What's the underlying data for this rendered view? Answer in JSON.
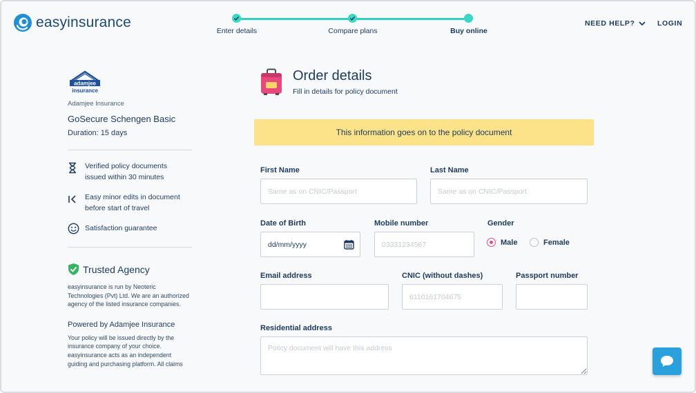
{
  "brand": {
    "name": "easyinsurance",
    "accent": "#2fd1c0",
    "primary": "#1b3a5c",
    "logo_icon": "easyinsurance-logo-icon"
  },
  "stepper": {
    "steps": [
      {
        "label": "Enter details",
        "state": "done"
      },
      {
        "label": "Compare plans",
        "state": "done"
      },
      {
        "label": "Buy online",
        "state": "current"
      }
    ]
  },
  "nav": {
    "help_label": "NEED HELP?",
    "login_label": "LOGIN"
  },
  "sidebar": {
    "insurer_logo_text": "adamjee insurance",
    "insurer_name": "Adamjee Insurance",
    "plan_name": "GoSecure Schengen Basic",
    "duration": "Duration: 15 days",
    "features": [
      {
        "icon": "hourglass-icon",
        "line1": "Verified policy documents",
        "line2": "issued within 30 minutes"
      },
      {
        "icon": "edit-back-icon",
        "line1": "Easy minor edits in document",
        "line2": "before start of travel"
      },
      {
        "icon": "smiley-icon",
        "line1": "Satisfaction guarantee",
        "line2": ""
      }
    ],
    "trusted_title": "Trusted Agency",
    "trusted_text": "easyinsurance is run by Neoteric Technologies (Pvt) Ltd. We are an authorized agency of the listed insurance companies.",
    "powered_title": "Powered by Adamjee Insurance",
    "powered_text": "Your policy will be issued directly by the insurance company of your choice. easyinsurance acts as an independent guiding and purchasing platform. All claims procedures would be handled by the"
  },
  "order": {
    "title": "Order details",
    "subtitle": "Fill in details for policy document",
    "notice": "This information goes on to the policy document"
  },
  "form": {
    "first_name": {
      "label": "First Name",
      "placeholder": "Same as on CNIC/Passport",
      "value": ""
    },
    "last_name": {
      "label": "Last Name",
      "placeholder": "Same as on CNIC/Passport",
      "value": ""
    },
    "dob": {
      "label": "Date of Birth",
      "value": "dd/mm/yyyy"
    },
    "mobile": {
      "label": "Mobile number",
      "placeholder": "03331234567",
      "value": ""
    },
    "gender": {
      "label": "Gender",
      "options": [
        "Male",
        "Female"
      ],
      "selected": "Male"
    },
    "email": {
      "label": "Email address",
      "value": ""
    },
    "cnic": {
      "label": "CNIC (without dashes)",
      "placeholder": "6110161704675",
      "value": ""
    },
    "passport": {
      "label": "Passport number",
      "value": ""
    },
    "address": {
      "label": "Residential address",
      "placeholder": "Policy document will have this address",
      "value": ""
    }
  },
  "chat": {
    "icon": "chat-bubble-icon",
    "color": "#2aa0dc"
  }
}
